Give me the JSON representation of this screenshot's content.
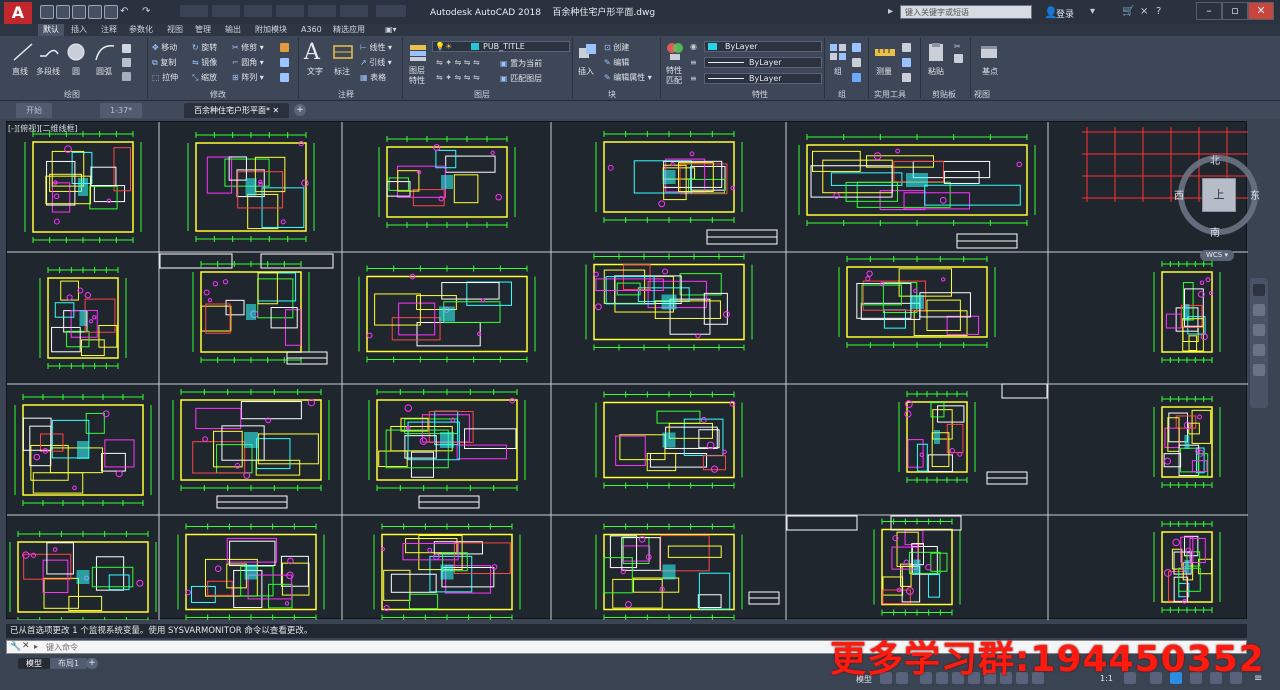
{
  "app": {
    "title": "Autodesk AutoCAD 2018",
    "filename": "百余种住宅户形平面.dwg",
    "workspace_tab": "A360",
    "search_placeholder": "键入关键字或短语",
    "login_label": "登录"
  },
  "menu_tabs": [
    "默认",
    "插入",
    "注释",
    "参数化",
    "视图",
    "管理",
    "输出",
    "附加模块",
    "A360",
    "精选应用"
  ],
  "ribbon": {
    "draw": {
      "title": "绘图",
      "line": "直线",
      "polyline": "多段线",
      "circle": "圆",
      "arc": "圆弧"
    },
    "modify": {
      "title": "修改",
      "move": "移动",
      "rotate": "旋转",
      "trim": "修剪",
      "copy": "复制",
      "mirror": "镜像",
      "fillet": "圆角",
      "stretch": "拉伸",
      "scale": "缩放",
      "array": "阵列"
    },
    "annotation": {
      "title": "注释",
      "text": "文字",
      "dimension": "标注",
      "linear": "线性",
      "leader": "引线",
      "table": "表格"
    },
    "layers": {
      "title": "图层",
      "layer_props": "图层特性",
      "current_layer": "PUB_TITLE",
      "make_current": "置为当前",
      "match_layer": "匹配图层"
    },
    "block": {
      "title": "块",
      "insert": "插入",
      "create": "创建",
      "edit": "编辑",
      "edit_attr": "编辑属性"
    },
    "properties": {
      "title": "特性",
      "match": "特性匹配",
      "color": "ByLayer",
      "linetype": "ByLayer",
      "lineweight": "ByLayer"
    },
    "groups": {
      "title": "组",
      "group": "组"
    },
    "utilities": {
      "title": "实用工具",
      "measure": "测量"
    },
    "clipboard": {
      "title": "剪贴板",
      "paste": "粘贴"
    },
    "view": {
      "title": "视图",
      "base": "基点"
    }
  },
  "doc_tabs": [
    "开始",
    "1-37*",
    "百余种住宅户形平面*"
  ],
  "viewport_label": "[-][俯视][二维线框]",
  "viewcube": {
    "north": "北",
    "south": "南",
    "east": "东",
    "west": "西",
    "top": "上",
    "wcs": "WCS"
  },
  "command": {
    "history": "已从首选项更改 1 个监视系统变量。使用 SYSVARMONITOR 命令以查看更改。",
    "placeholder": "键入命令"
  },
  "layout_tabs": [
    "模型",
    "布局1"
  ],
  "status": {
    "model": "模型",
    "scale": "1:1"
  },
  "watermark": "更多学习群:194450352",
  "colors": {
    "cad_bg": "#20262e",
    "ribbon_bg": "#3e4758",
    "accent_red": "#c1272d",
    "watermark": "#ff1a10"
  }
}
